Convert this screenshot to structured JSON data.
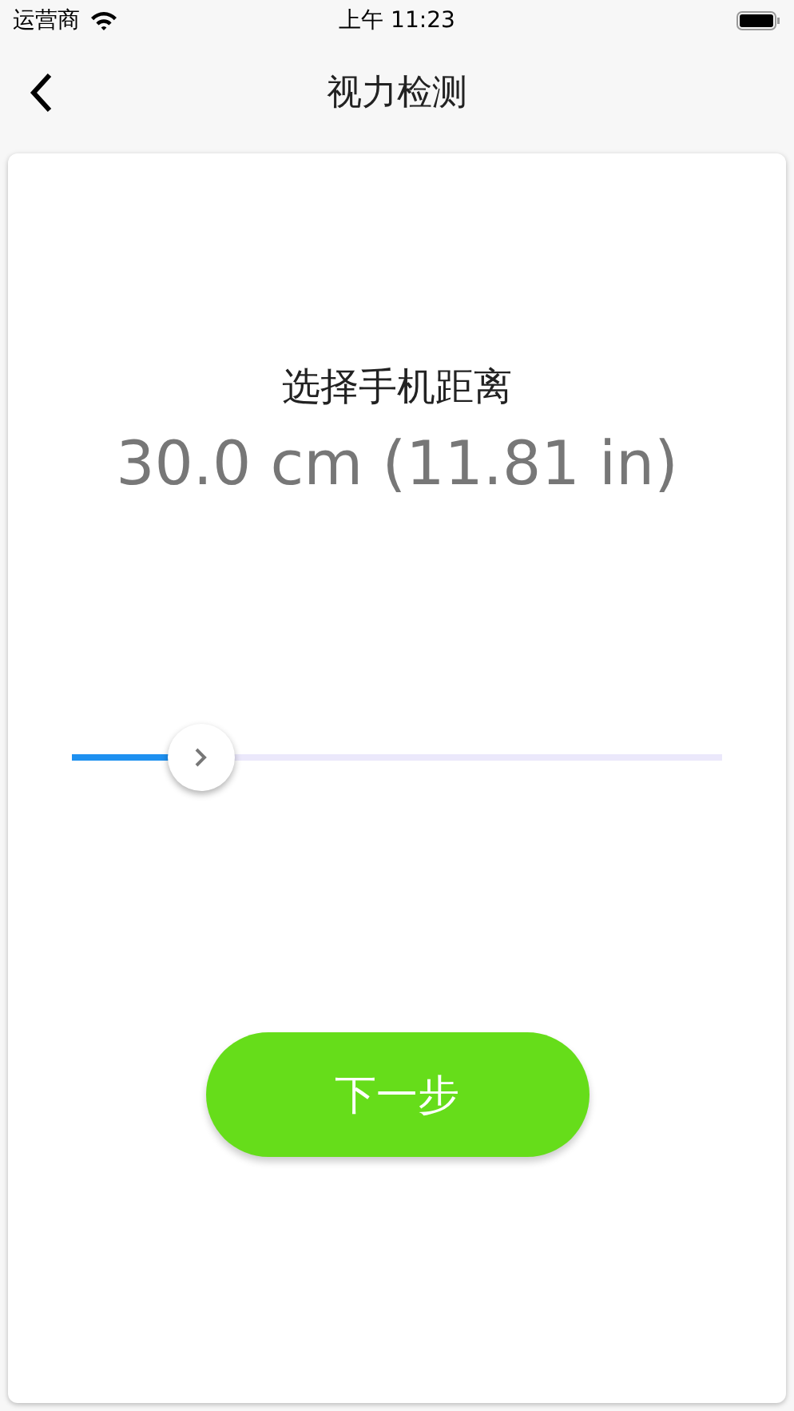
{
  "status_bar": {
    "carrier": "运营商",
    "time": "上午 11:23"
  },
  "nav": {
    "title": "视力检测"
  },
  "content": {
    "heading": "选择手机距离",
    "reading": "30.0 cm (11.81 in)"
  },
  "slider": {
    "level": 0.2
  },
  "next_button": {
    "label": "下一步"
  }
}
